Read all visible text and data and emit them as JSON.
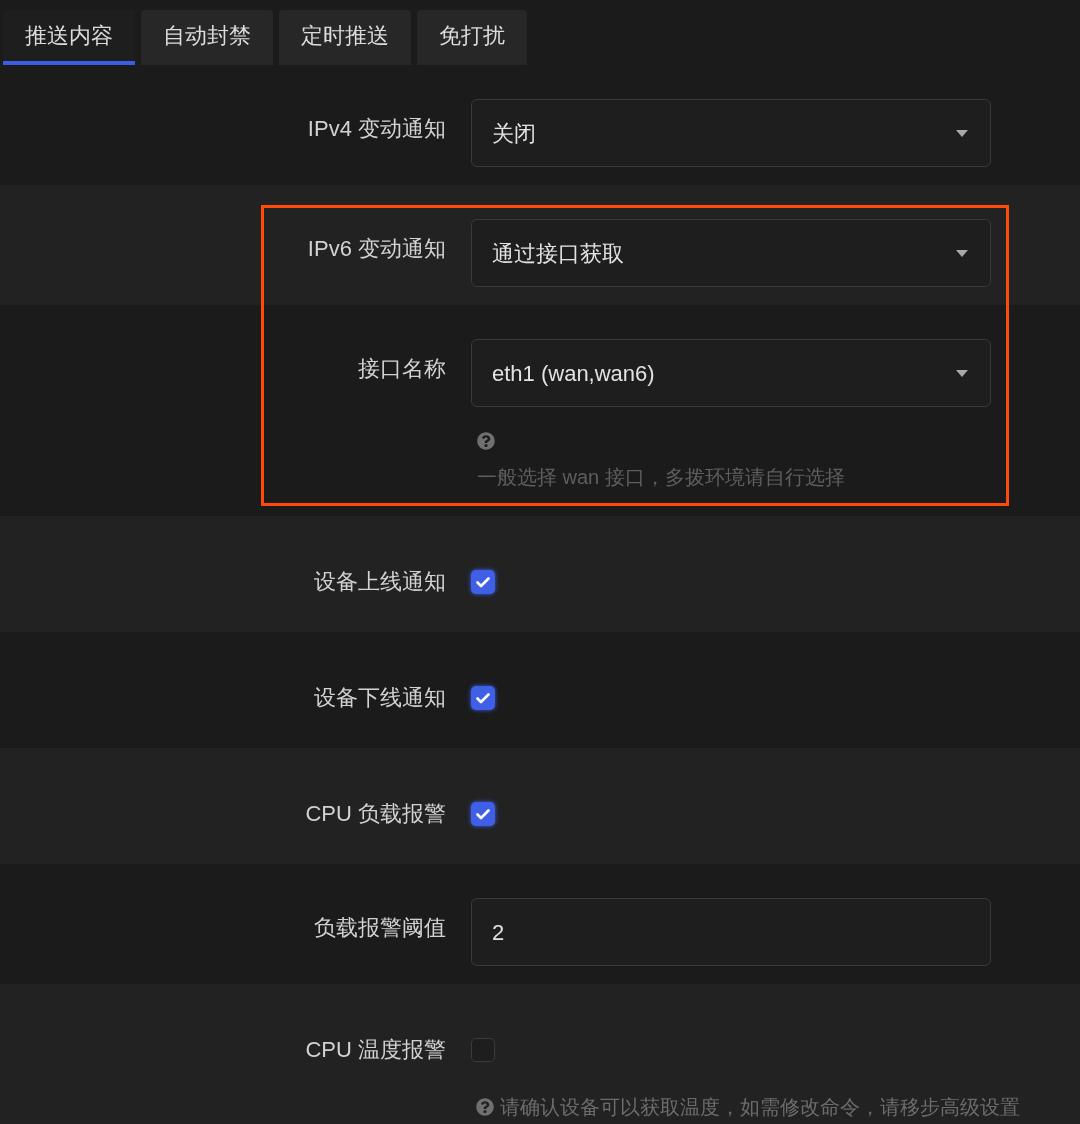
{
  "tabs": [
    {
      "label": "推送内容",
      "selected": true
    },
    {
      "label": "自动封禁",
      "selected": false
    },
    {
      "label": "定时推送",
      "selected": false
    },
    {
      "label": "免打扰",
      "selected": false
    }
  ],
  "rows": [
    {
      "kind": "select",
      "label": "IPv4 变动通知",
      "value": "关闭",
      "highlighted": false
    },
    {
      "kind": "select",
      "label": "IPv6 变动通知",
      "value": "通过接口获取",
      "highlighted": true
    },
    {
      "kind": "select",
      "label": "接口名称",
      "value": "eth1 (wan,wan6)",
      "highlighted": true,
      "help": "一般选择 wan 接口，多拨环境请自行选择"
    },
    {
      "kind": "checkbox",
      "label": "设备上线通知",
      "checked": true,
      "highlighted": false
    },
    {
      "kind": "checkbox",
      "label": "设备下线通知",
      "checked": true,
      "highlighted": false
    },
    {
      "kind": "checkbox",
      "label": "CPU 负载报警",
      "checked": true,
      "highlighted": false
    },
    {
      "kind": "input",
      "label": "负载报警阈值",
      "value": "2",
      "highlighted": false
    },
    {
      "kind": "checkbox",
      "label": "CPU 温度报警",
      "checked": false,
      "highlighted": false,
      "help": "请确认设备可以获取温度，如需修改命令，请移步高级设置"
    }
  ]
}
